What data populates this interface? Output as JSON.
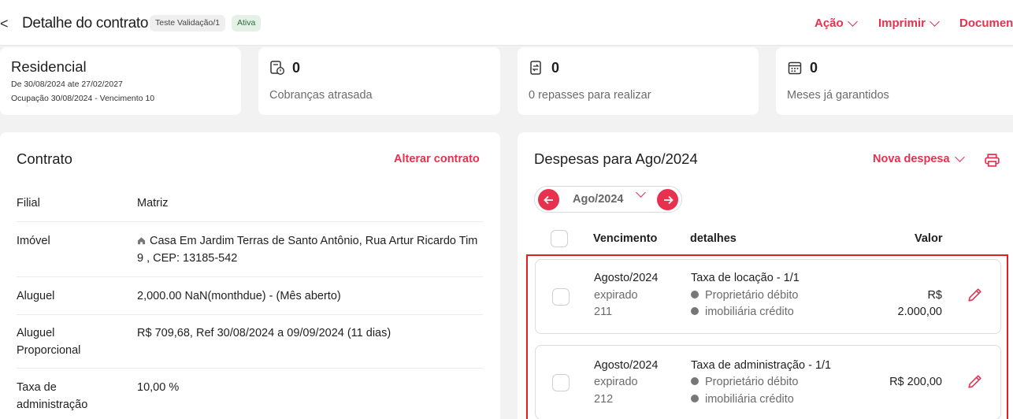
{
  "header": {
    "back": "<",
    "title": "Detalhe do contrato",
    "tag_code": "Teste Validação/1",
    "tag_status": "Ativa",
    "menu": [
      {
        "label": "Ação"
      },
      {
        "label": "Imprimir"
      },
      {
        "label": "Document"
      }
    ]
  },
  "summary": {
    "type_title": "Residencial",
    "period": "De 30/08/2024 ate 27/02/2027",
    "occupancy": "Ocupação 30/08/2024 - Vencimento 10",
    "stats": [
      {
        "icon": "overdue-invoice-icon",
        "value": "0",
        "label": "Cobranças atrasada"
      },
      {
        "icon": "transfer-icon",
        "value": "0",
        "label": "0 repasses para realizar"
      },
      {
        "icon": "calendar-icon",
        "value": "0",
        "label": "Meses já garantidos"
      }
    ]
  },
  "contract": {
    "title": "Contrato",
    "edit_label": "Alterar contrato",
    "rows": [
      {
        "label": "Filial",
        "value": "Matriz"
      },
      {
        "label": "Imóvel",
        "value": "Casa Em Jardim Terras de Santo Antônio, Rua Artur Ricardo Tim 9 , CEP: 13185-542"
      },
      {
        "label": "Aluguel",
        "value": "2,000.00 NaN(monthdue) - (Mês aberto)"
      },
      {
        "label": "Aluguel Proporcional",
        "value": "R$ 709,68, Ref 30/08/2024 a 09/09/2024 (11 dias)"
      },
      {
        "label": "Taxa de administração",
        "value": "10,00 %"
      }
    ]
  },
  "expenses": {
    "title": "Despesas para Ago/2024",
    "new_label": "Nova despesa",
    "month": "Ago/2024",
    "columns": {
      "due": "Vencimento",
      "details": "detalhes",
      "value": "Valor"
    },
    "items": [
      {
        "month": "Agosto/2024",
        "status": "expirado",
        "code": "211",
        "title": "Taxa de locação - 1/1",
        "debit": "Proprietário débito",
        "credit": "imobiliária crédito",
        "value": "R$ 2.000,00"
      },
      {
        "month": "Agosto/2024",
        "status": "expirado",
        "code": "212",
        "title": "Taxa de administração - 1/1",
        "debit": "Proprietário débito",
        "credit": "imobiliária crédito",
        "value": "R$ 200,00"
      }
    ]
  },
  "colors": {
    "accent": "#e8304f",
    "success_bg": "#e3f1e6",
    "page_bg": "#f2f2f2"
  }
}
